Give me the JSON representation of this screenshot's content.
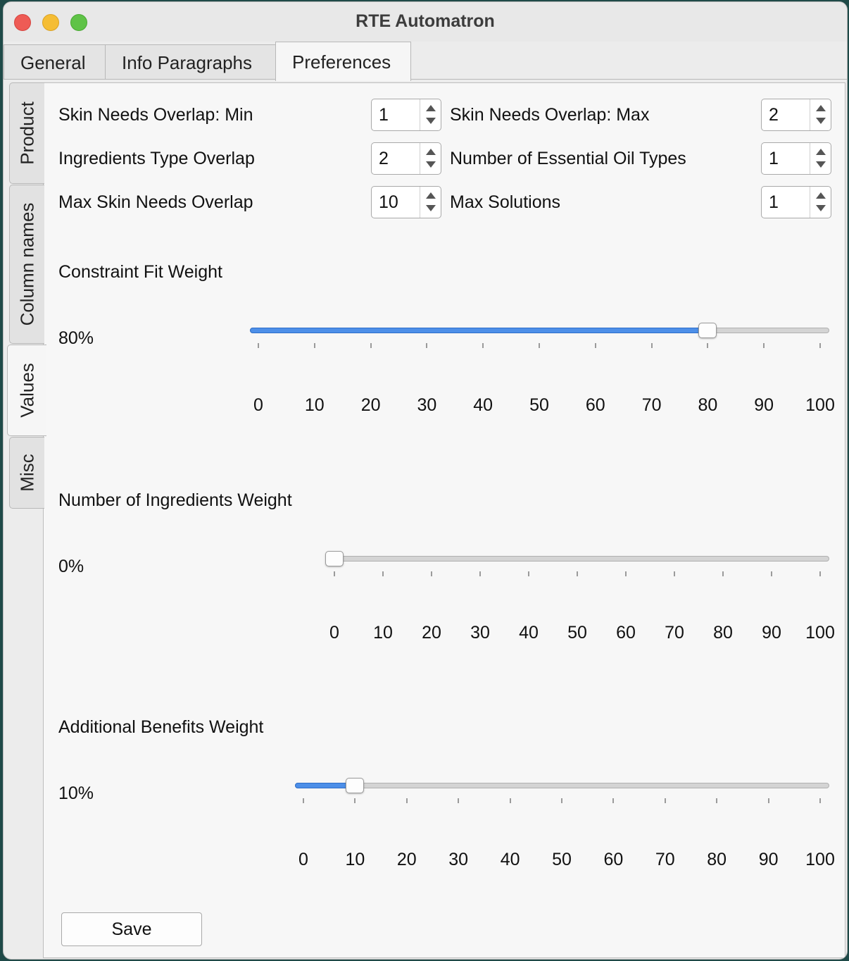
{
  "window": {
    "title": "RTE Automatron"
  },
  "top_tabs": [
    {
      "label": "General"
    },
    {
      "label": "Info Paragraphs"
    },
    {
      "label": "Preferences"
    }
  ],
  "side_tabs": [
    {
      "label": "Product"
    },
    {
      "label": "Column names"
    },
    {
      "label": "Values"
    },
    {
      "label": "Misc"
    }
  ],
  "fields": [
    {
      "label": "Skin Needs Overlap: Min",
      "value": "1"
    },
    {
      "label": "Skin Needs Overlap: Max",
      "value": "2"
    },
    {
      "label": "Ingredients Type Overlap",
      "value": "2"
    },
    {
      "label": "Number of Essential Oil Types",
      "value": "1"
    },
    {
      "label": "Max Skin Needs Overlap",
      "value": "10"
    },
    {
      "label": "Max Solutions",
      "value": "1"
    }
  ],
  "sliders": [
    {
      "title": "Constraint Fit Weight",
      "value_label": "80%",
      "value": 80,
      "ticks": [
        "0",
        "10",
        "20",
        "30",
        "40",
        "50",
        "60",
        "70",
        "80",
        "90",
        "100"
      ]
    },
    {
      "title": "Number of Ingredients Weight",
      "value_label": "0%",
      "value": 0,
      "ticks": [
        "0",
        "10",
        "20",
        "30",
        "40",
        "50",
        "60",
        "70",
        "80",
        "90",
        "100"
      ]
    },
    {
      "title": "Additional Benefits Weight",
      "value_label": "10%",
      "value": 10,
      "ticks": [
        "0",
        "10",
        "20",
        "30",
        "40",
        "50",
        "60",
        "70",
        "80",
        "90",
        "100"
      ]
    }
  ],
  "save_label": "Save",
  "colors": {
    "accent": "#4d8fe8",
    "close": "#ee5b55",
    "minimize": "#f5bd34",
    "maximize": "#5fc347"
  }
}
